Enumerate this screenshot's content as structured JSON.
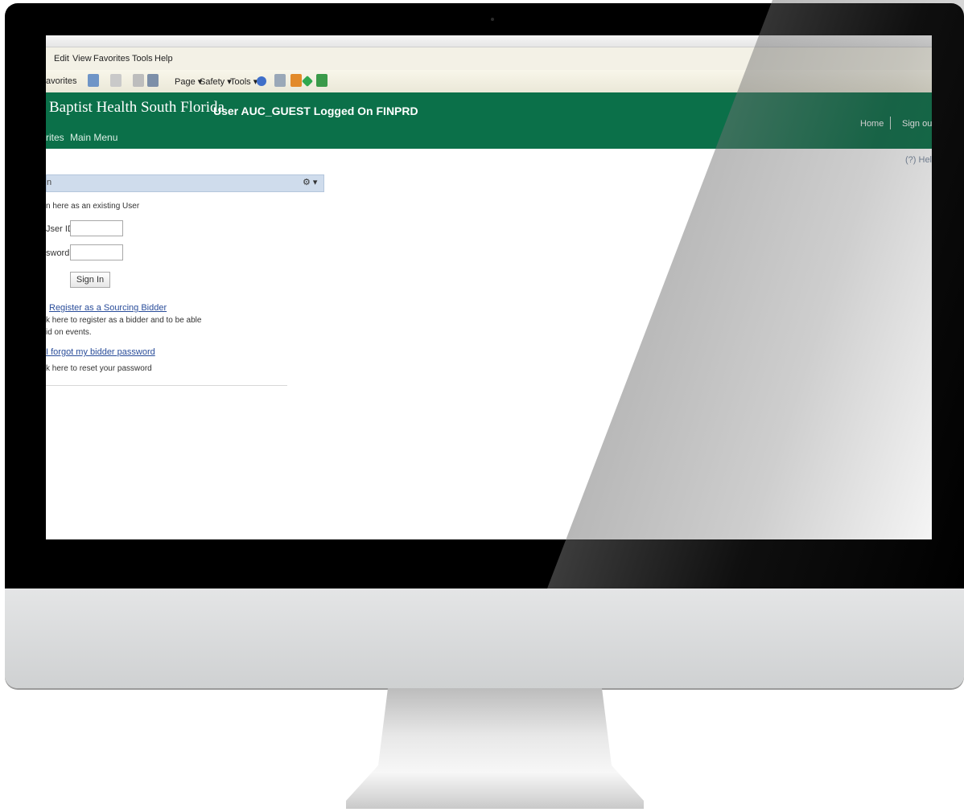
{
  "browser": {
    "menu": [
      "Edit",
      "View",
      "Favorites",
      "Tools",
      "Help"
    ],
    "toolbar": {
      "favorites": "avorites",
      "page": "Page ▾",
      "safety": "Safety ▾",
      "tools": "Tools ▾"
    }
  },
  "header": {
    "org_name": "Baptist Health South Florida",
    "user_status": "User AUC_GUEST Logged On FINPRD",
    "links": {
      "home": "Home",
      "signout": "Sign out"
    },
    "nav": {
      "favorites": "rites",
      "main_menu": "Main Menu"
    },
    "colors": {
      "brand": "#0b7049"
    }
  },
  "help": {
    "label": "(?) Help"
  },
  "signin": {
    "pagelet_title": "n",
    "gear": "⚙ ▾",
    "intro": "n here as an existing User",
    "userid_label": "Jser ID:",
    "userid_value": "",
    "password_label": "sword:",
    "password_value": "",
    "signin_button": "Sign In",
    "register_link": "Register as a Sourcing Bidder",
    "register_desc_1": "k here to register as a bidder and to be able",
    "register_desc_2": "id on events.",
    "forgot_link": "I forgot my bidder password",
    "forgot_desc": "k here to reset your password"
  }
}
